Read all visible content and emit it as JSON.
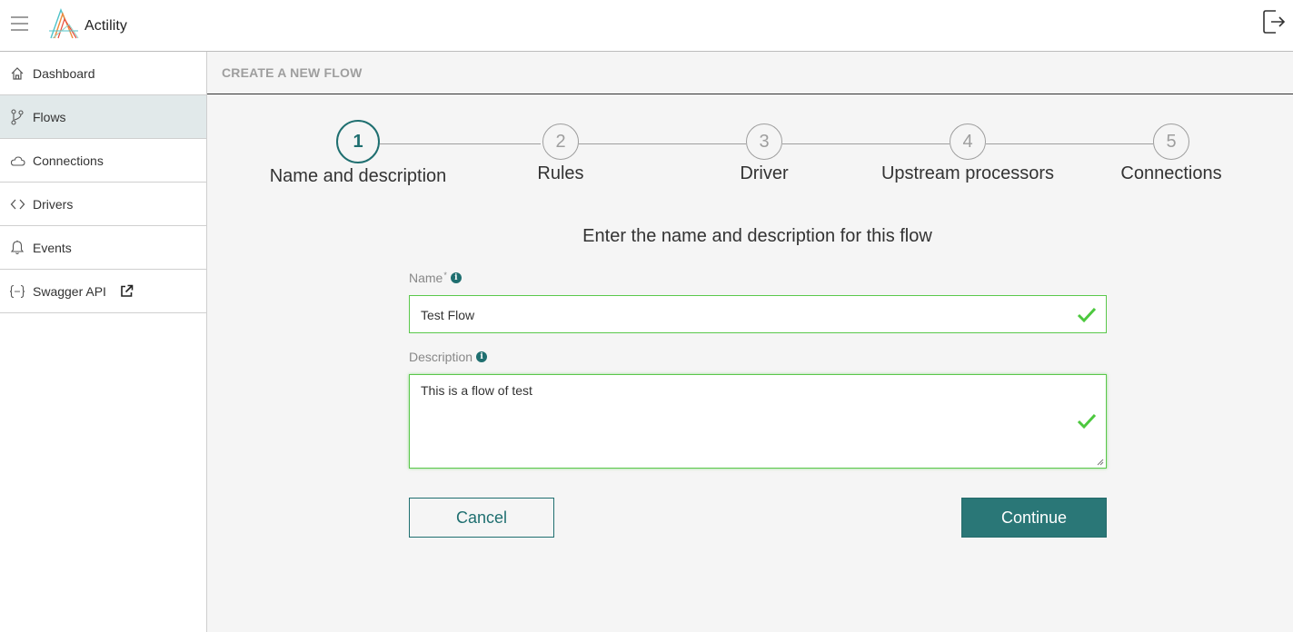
{
  "header": {
    "app_name": "Actility",
    "icons": [
      "hamburger-menu-icon",
      "actility-logo",
      "logout-icon"
    ]
  },
  "sidebar": {
    "items": [
      {
        "label": "Dashboard",
        "icon": "home-icon",
        "active": false
      },
      {
        "label": "Flows",
        "icon": "flow-branch-icon",
        "active": true
      },
      {
        "label": "Connections",
        "icon": "cloud-icon",
        "active": false
      },
      {
        "label": "Drivers",
        "icon": "code-brackets-icon",
        "active": false
      },
      {
        "label": "Events",
        "icon": "bell-icon",
        "active": false
      },
      {
        "label": "Swagger API",
        "icon": "curly-braces-icon",
        "active": false,
        "external": true
      }
    ]
  },
  "main": {
    "page_title": "CREATE A NEW FLOW",
    "steps": [
      {
        "number": "1",
        "label": "Name and description",
        "active": true
      },
      {
        "number": "2",
        "label": "Rules",
        "active": false
      },
      {
        "number": "3",
        "label": "Driver",
        "active": false
      },
      {
        "number": "4",
        "label": "Upstream processors",
        "active": false
      },
      {
        "number": "5",
        "label": "Connections",
        "active": false
      }
    ],
    "form": {
      "heading": "Enter the name and description for this flow",
      "name_label": "Name",
      "name_required_mark": "*",
      "name_value": "Test Flow",
      "description_label": "Description",
      "description_value": "This is a flow of test",
      "info_glyph": "i",
      "cancel_label": "Cancel",
      "continue_label": "Continue"
    },
    "colors": {
      "accent": "#1f6f70",
      "button_primary": "#2a7777",
      "valid": "#5ac84b",
      "active_nav_bg": "#e1e9ea"
    }
  }
}
